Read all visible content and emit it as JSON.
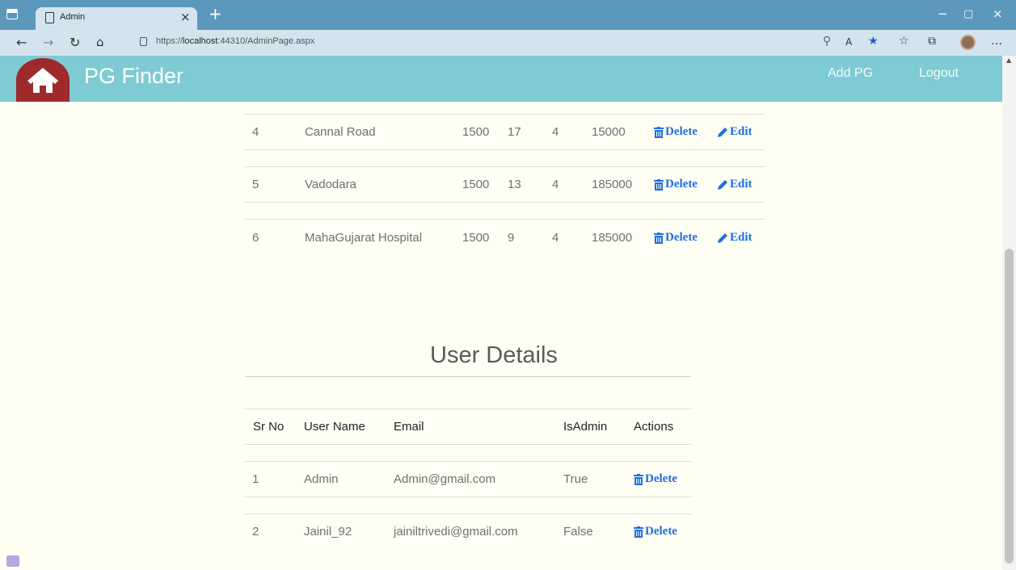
{
  "browser": {
    "tab_title": "Admin",
    "url_prefix": "https://",
    "url_host": "localhost",
    "url_rest": ":44310/AdminPage.aspx"
  },
  "header": {
    "brand": "PG Finder",
    "nav": [
      "Add PG",
      "Logout"
    ]
  },
  "pg_table": {
    "rows": [
      {
        "sr": "4",
        "location": "Cannal Road",
        "rent": "1500",
        "col3": "17",
        "col4": "4",
        "deposit": "15000"
      },
      {
        "sr": "5",
        "location": "Vadodara",
        "rent": "1500",
        "col3": "13",
        "col4": "4",
        "deposit": "185000"
      },
      {
        "sr": "6",
        "location": "MahaGujarat Hospital",
        "rent": "1500",
        "col3": "9",
        "col4": "4",
        "deposit": "185000"
      }
    ],
    "delete_label": "Delete",
    "edit_label": "Edit"
  },
  "user_section": {
    "title": "User Details",
    "headers": [
      "Sr No",
      "User Name",
      "Email",
      "IsAdmin",
      "Actions"
    ],
    "rows": [
      {
        "sr": "1",
        "username": "Admin",
        "email": "Admin@gmail.com",
        "is_admin": "True"
      },
      {
        "sr": "2",
        "username": "Jainil_92",
        "email": "jainiltrivedi@gmail.com",
        "is_admin": "False"
      }
    ],
    "delete_label": "Delete"
  },
  "colors": {
    "header_bg": "#7ecbd3",
    "page_bg": "#fffef3",
    "action_blue": "#1f6ee6",
    "logo_red": "#9e2a2b",
    "tabbar": "#5c98bc"
  }
}
